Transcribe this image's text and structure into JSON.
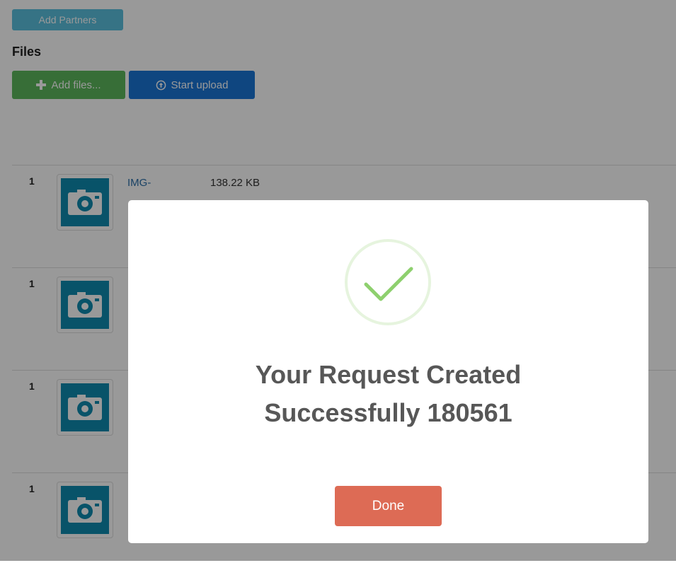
{
  "toolbar": {
    "add_partners_label": "Add Partners",
    "files_heading": "Files",
    "add_files_label": "Add files...",
    "start_upload_label": "Start upload"
  },
  "files": [
    {
      "index": "1",
      "name": "IMG-",
      "size": "138.22 KB"
    },
    {
      "index": "1",
      "name": "",
      "size": ""
    },
    {
      "index": "1",
      "name": "",
      "size": ""
    },
    {
      "index": "1",
      "name": "",
      "size": ""
    }
  ],
  "modal": {
    "message": "Your Request Created\nSuccessfully 180561",
    "done_label": "Done"
  },
  "colors": {
    "partners_button": "#5bc0de",
    "add_files_button": "#5cb85c",
    "upload_button": "#1a76d6",
    "done_button": "#dd6b55",
    "success_check": "#8ed06e"
  },
  "icons": {
    "add_files": "plus-icon",
    "start_upload": "upload-icon",
    "thumbnail": "camera-icon",
    "success": "checkmark-icon"
  }
}
